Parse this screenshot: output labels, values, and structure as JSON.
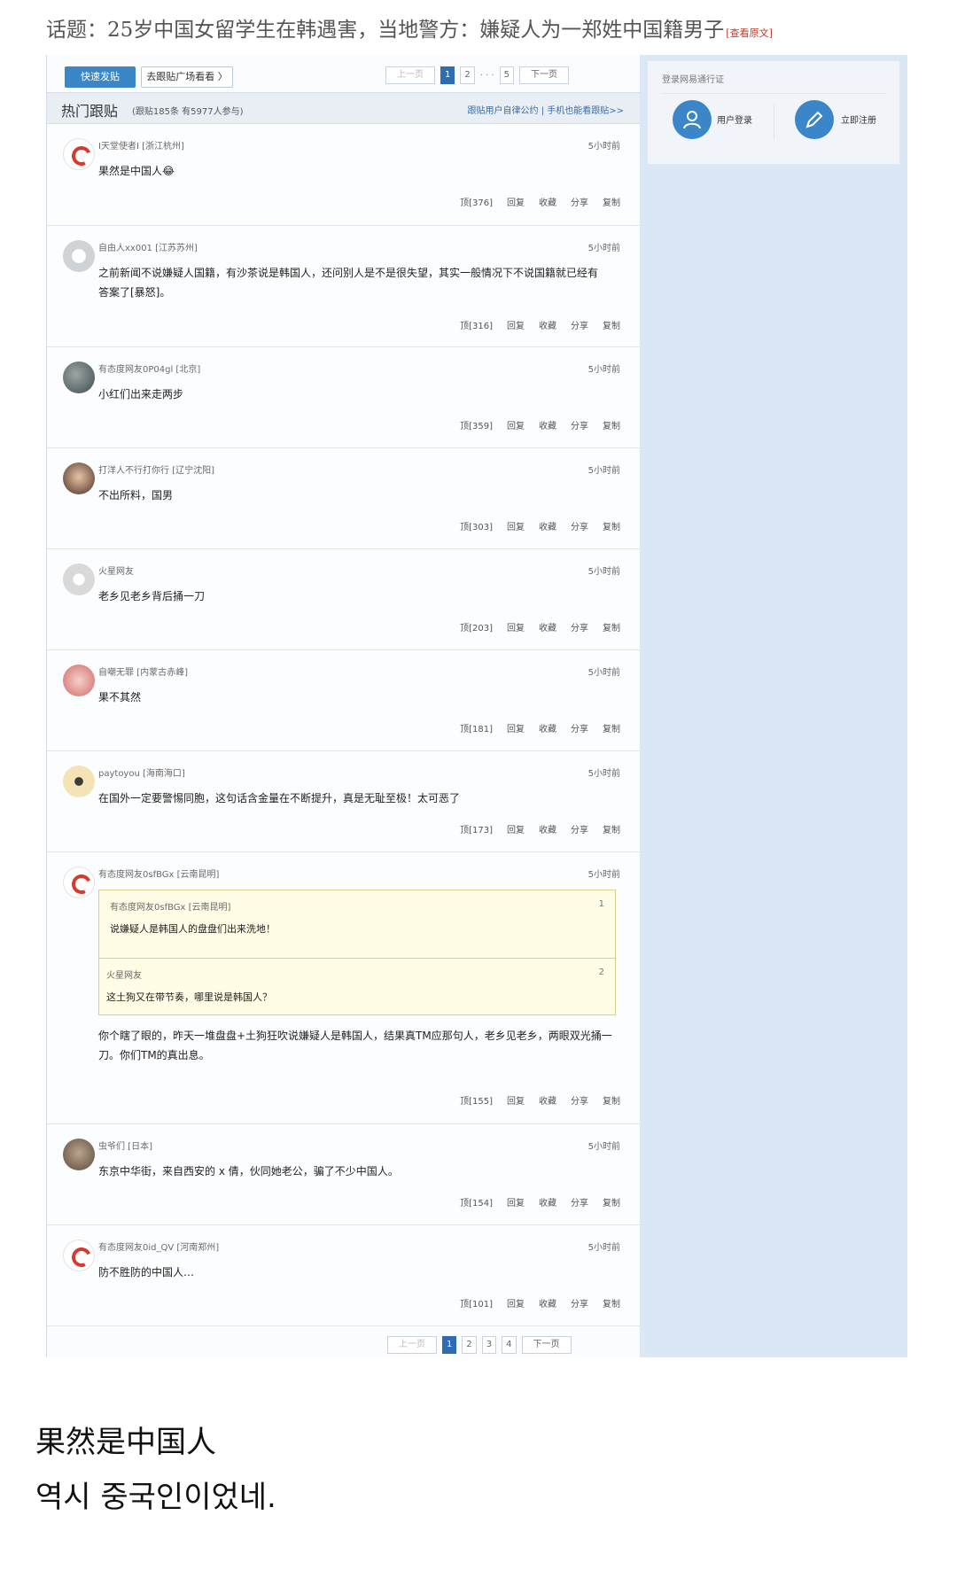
{
  "topic": {
    "title": "话题：25岁中国女留学生在韩遇害，当地警方：嫌疑人为一郑姓中国籍男子",
    "view_original": "[查看原文]"
  },
  "toolbar": {
    "fast_post": "快速发贴",
    "go_plaza": "去跟贴广场看看 〉",
    "pager": {
      "prev": "上一页",
      "pages": [
        "1",
        "2",
        "5"
      ],
      "ellipsis": "· · ·",
      "next": "下一页",
      "current": "1"
    }
  },
  "header": {
    "hot": "热门跟贴",
    "stats": "(跟贴185条 有5977人参与)",
    "links": "跟贴用户自律公约 | 手机也能看跟贴>>"
  },
  "action_labels": {
    "reply": "回复",
    "favorite": "收藏",
    "share": "分享",
    "copy": "复制"
  },
  "comments": [
    {
      "user": "I天堂使者I [浙江杭州]",
      "time": "5小时前",
      "text": "果然是中国人😂",
      "up": "顶[376]"
    },
    {
      "user": "自由人xx001 [江苏苏州]",
      "time": "5小时前",
      "text": "之前新闻不说嫌疑人国籍，有沙茶说是韩国人，还问别人是不是很失望，其实一般情况下不说国籍就已经有答案了[暴怒]。",
      "up": "顶[316]"
    },
    {
      "user": "有态度网友0P04gl [北京]",
      "time": "5小时前",
      "text": "小红们出来走两步",
      "up": "顶[359]"
    },
    {
      "user": "打洋人不行打你行 [辽宁沈阳]",
      "time": "5小时前",
      "text": "不出所料，国男",
      "up": "顶[303]"
    },
    {
      "user": "火星网友",
      "time": "5小时前",
      "text": "老乡见老乡背后捅一刀",
      "up": "顶[203]"
    },
    {
      "user": "自嘲无罪 [内蒙古赤峰]",
      "time": "5小时前",
      "text": "果不其然",
      "up": "顶[181]"
    },
    {
      "user": "paytoyou [海南海口]",
      "time": "5小时前",
      "text": "在国外一定要警惕同胞，这句话含金量在不断提升，真是无耻至极！太可恶了",
      "up": "顶[173]"
    },
    {
      "user": "有态度网友0sfBGx [云南昆明]",
      "time": "5小时前",
      "quote1_user": "有态度网友0sfBGx [云南昆明]",
      "quote1_num": "1",
      "quote1_text": "说嫌疑人是韩国人的盘盘们出来洗地！",
      "quote2_user": "火星网友",
      "quote2_num": "2",
      "quote2_text": "这土狗又在带节奏，哪里说是韩国人？",
      "text": "你个瞎了眼的，昨天一堆盘盘+土狗狂吹说嫌疑人是韩国人，结果真TM应那句人，老乡见老乡，两眼双光捅一刀。你们TM的真出息。",
      "up": "顶[155]"
    },
    {
      "user": "虫爷们 [日本]",
      "time": "5小时前",
      "text": "东京中华街，来自西安的 x 倩，伙同她老公，骗了不少中国人。",
      "up": "顶[154]"
    },
    {
      "user": "有态度网友0id_QV [河南郑州]",
      "time": "5小时前",
      "text": "防不胜防的中国人…",
      "up": "顶[101]"
    }
  ],
  "bottom_pager": {
    "prev": "上一页",
    "pages": [
      "1",
      "2",
      "3",
      "4"
    ],
    "next": "下一页",
    "current": "1"
  },
  "sidebar": {
    "title": "登录网易通行证",
    "login": "用户登录",
    "register": "立即注册"
  },
  "captions": {
    "zh": "果然是中国人",
    "ko": "역시 중국인이었네."
  },
  "colors": {
    "accent": "#3b86c7",
    "sidebar_bg": "#dbe7f4",
    "quote_bg": "#fffde6"
  }
}
